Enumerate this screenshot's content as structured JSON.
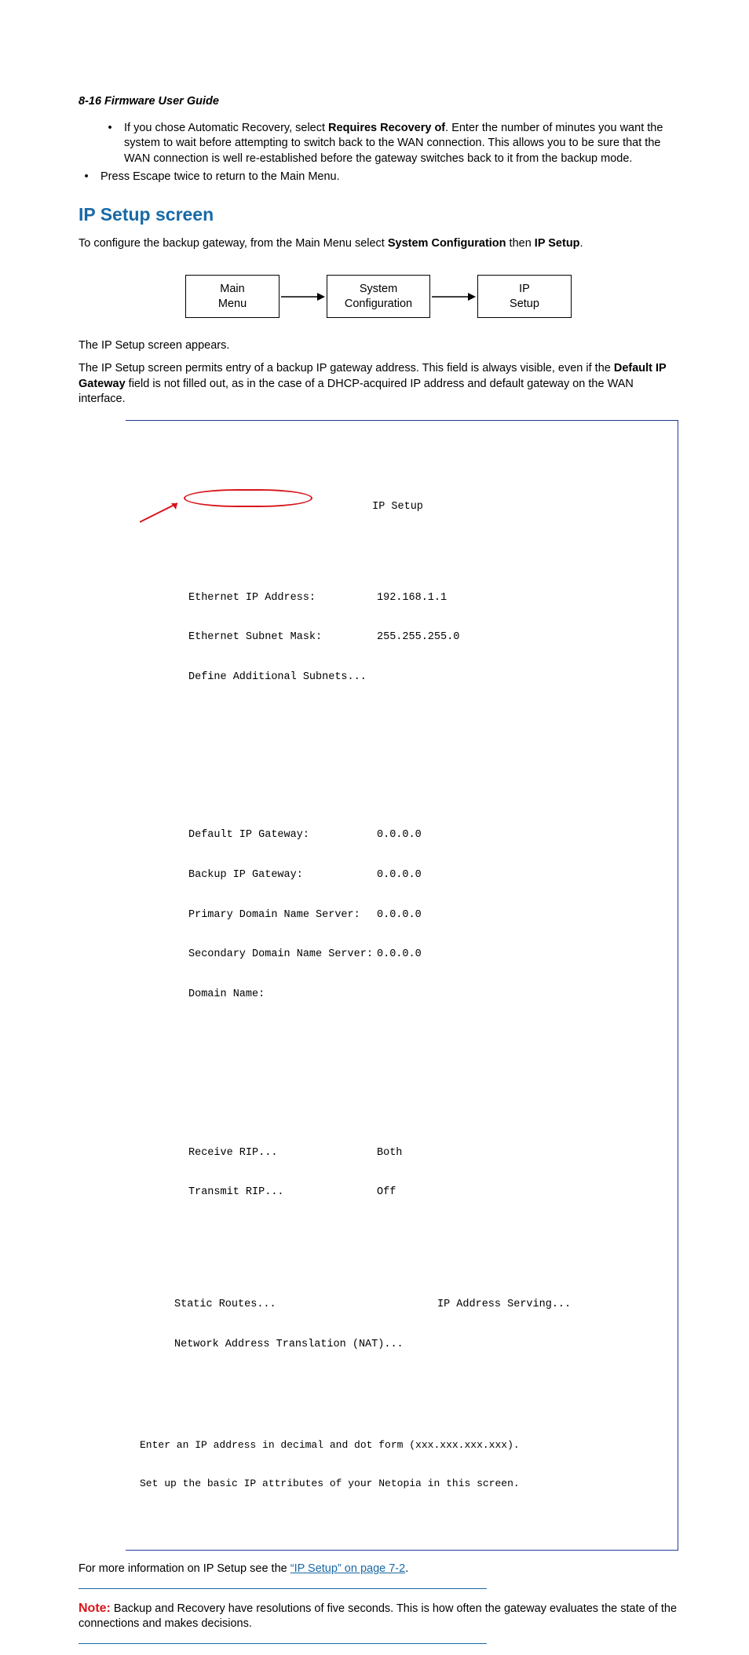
{
  "header": "8-16  Firmware User Guide",
  "bullet1_prefix": "If you chose Automatic Recovery, select ",
  "bullet1_bold": "Requires Recovery of",
  "bullet1_suffix": ". Enter the number of minutes you want the system to wait before attempting to switch back to the WAN connection. This allows you to be sure that the WAN connection is well re-established before the gateway switches back to it from the backup mode.",
  "bullet2": "Press Escape twice to return to the Main Menu.",
  "section_title": "IP Setup screen",
  "intro_prefix": "To configure the backup gateway, from the Main Menu select ",
  "intro_bold1": "System Configuration",
  "intro_mid": " then ",
  "intro_bold2": "IP Setup",
  "intro_suffix": ".",
  "nav": {
    "box1_l1": "Main",
    "box1_l2": "Menu",
    "box2_l1": "System",
    "box2_l2": "Configuration",
    "box3_l1": "IP",
    "box3_l2": "Setup"
  },
  "para_appears": "The IP Setup screen appears.",
  "para_permits_prefix": "The IP Setup screen permits entry of a backup IP gateway address. This field is always visible, even if the ",
  "para_permits_bold": "Default IP Gateway",
  "para_permits_suffix": " field is not filled out, as in the case of a DHCP-acquired IP address and default gateway on the WAN interface.",
  "terminal": {
    "title": "IP Setup",
    "rows": [
      {
        "label": "Ethernet IP Address:",
        "value": "192.168.1.1"
      },
      {
        "label": "Ethernet Subnet Mask:",
        "value": "255.255.255.0"
      },
      {
        "label": "Define Additional Subnets...",
        "value": ""
      }
    ],
    "rows2": [
      {
        "label": "Default IP Gateway:",
        "value": "0.0.0.0"
      },
      {
        "label": "Backup IP Gateway:",
        "value": "0.0.0.0"
      },
      {
        "label": "Primary Domain Name Server:",
        "value": "0.0.0.0"
      },
      {
        "label": "Secondary Domain Name Server:",
        "value": "0.0.0.0"
      },
      {
        "label": "Domain Name:",
        "value": ""
      }
    ],
    "rows3": [
      {
        "label": "Receive RIP...",
        "value": "Both"
      },
      {
        "label": "Transmit RIP...",
        "value": "Off"
      }
    ],
    "static_left": "Static Routes...",
    "static_right": "IP Address Serving...",
    "nat": "Network Address Translation (NAT)...",
    "footer1": "Enter an IP address in decimal and dot form (xxx.xxx.xxx.xxx).",
    "footer2": "Set up the basic IP attributes of your Netopia in this screen."
  },
  "more_info_prefix": "For more information on IP Setup see the ",
  "more_info_link": "“IP Setup” on page 7-2",
  "more_info_suffix": ".",
  "note_label": "Note:",
  "note_text": "  Backup and Recovery have resolutions of five seconds. This is how often the gateway evaluates the state of the connections and makes decisions."
}
